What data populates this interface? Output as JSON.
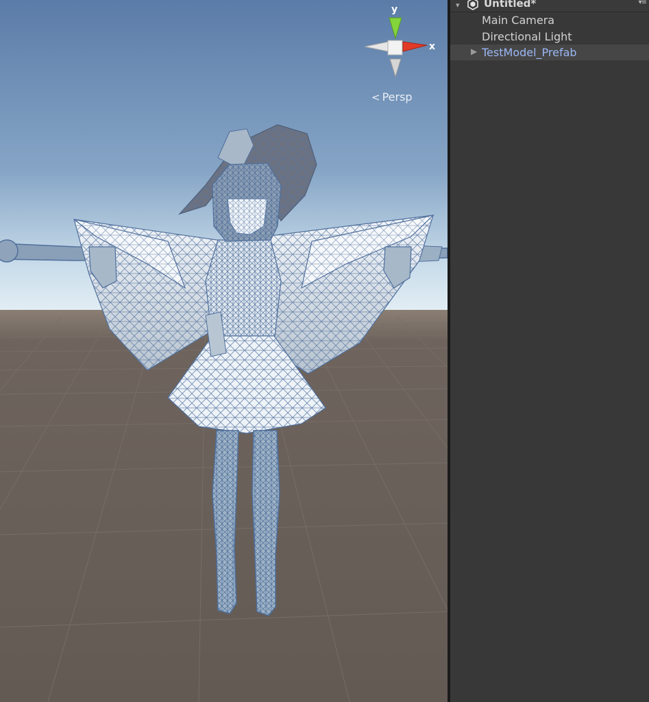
{
  "hierarchy": {
    "scene_name": "Untitled*",
    "items": [
      {
        "label": "Main Camera"
      },
      {
        "label": "Directional Light"
      },
      {
        "label": "TestModel_Prefab"
      }
    ]
  },
  "scene_view": {
    "projection_label": "Persp",
    "gizmo_axes": {
      "y": "y",
      "x": "x"
    },
    "colors": {
      "sky_top": "#5f80ad",
      "sky_horizon": "#dfecf3",
      "ground": "#665d57",
      "wire": "#5878a8",
      "axis_x": "#e03a28",
      "axis_y": "#7ed23a"
    }
  }
}
